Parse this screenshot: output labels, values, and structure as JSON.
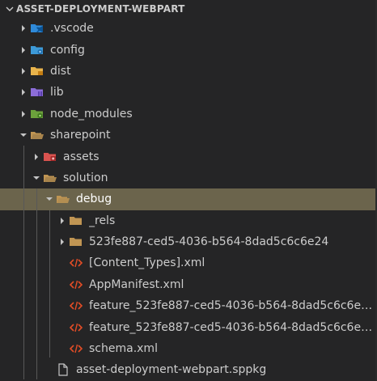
{
  "explorer": {
    "section_title": "ASSET-DEPLOYMENT-WEBPART",
    "colors": {
      "background": "#252526",
      "selected_row": "#6b644c",
      "folder": "#c09553",
      "xml_icon": "#e44d26",
      "vscode_folder": "#2f8ad9",
      "config_folder": "#3d9ad8",
      "dist_folder": "#e9b44c",
      "lib_folder": "#8c6dd8",
      "node_modules_folder": "#6ca13c",
      "assets_folder": "#d9534f"
    },
    "items": [
      {
        "label": ".vscode",
        "depth": 1,
        "expanded": false,
        "icon": "vscode-folder-icon"
      },
      {
        "label": "config",
        "depth": 1,
        "expanded": false,
        "icon": "config-folder-icon"
      },
      {
        "label": "dist",
        "depth": 1,
        "expanded": false,
        "icon": "dist-folder-icon"
      },
      {
        "label": "lib",
        "depth": 1,
        "expanded": false,
        "icon": "lib-folder-icon"
      },
      {
        "label": "node_modules",
        "depth": 1,
        "expanded": false,
        "icon": "node-modules-folder-icon"
      },
      {
        "label": "sharepoint",
        "depth": 1,
        "expanded": true,
        "icon": "folder-open-icon"
      },
      {
        "label": "assets",
        "depth": 2,
        "expanded": false,
        "icon": "assets-folder-icon"
      },
      {
        "label": "solution",
        "depth": 2,
        "expanded": true,
        "icon": "folder-open-icon"
      },
      {
        "label": "debug",
        "depth": 3,
        "expanded": true,
        "icon": "folder-open-icon",
        "selected": true
      },
      {
        "label": "_rels",
        "depth": 4,
        "expanded": false,
        "icon": "folder-icon"
      },
      {
        "label": "523fe887-ced5-4036-b564-8dad5c6c6e24",
        "depth": 4,
        "expanded": false,
        "icon": "folder-icon"
      },
      {
        "label": "[Content_Types].xml",
        "depth": 4,
        "icon": "xml-file-icon"
      },
      {
        "label": "AppManifest.xml",
        "depth": 4,
        "icon": "xml-file-icon"
      },
      {
        "label": "feature_523fe887-ced5-4036-b564-8dad5c6c6e2...",
        "depth": 4,
        "icon": "xml-file-icon"
      },
      {
        "label": "feature_523fe887-ced5-4036-b564-8dad5c6c6e2...",
        "depth": 4,
        "icon": "xml-file-icon"
      },
      {
        "label": "schema.xml",
        "depth": 4,
        "icon": "xml-file-icon"
      },
      {
        "label": "asset-deployment-webpart.sppkg",
        "depth": 3,
        "icon": "file-icon"
      }
    ]
  }
}
